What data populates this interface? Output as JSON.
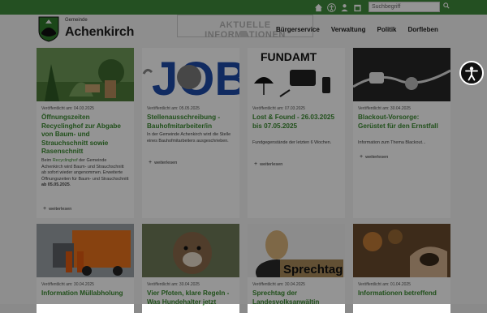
{
  "header": {
    "municipality_small": "Gemeinde",
    "municipality_name": "Achenkirch",
    "notice_title": "AKTUELLE INFORMATIONEN",
    "search_placeholder": "Suchbegriff",
    "nav": [
      "Bürgerservice",
      "Verwaltung",
      "Politik",
      "Dorfleben"
    ]
  },
  "topbar_icons": [
    "home-icon",
    "accessibility-icon",
    "user-icon",
    "calendar-icon"
  ],
  "colors": {
    "brand_green": "#3f8a3b",
    "title_green": "#3a8a30"
  },
  "read_more": "weiterlesen",
  "news": [
    {
      "date": "Veröffentlicht am: 04.03.2025",
      "title": "Öffnungszeiten Recyclinghof zur Abgabe von Baum- und Strauchschnitt sowie Rasenschnitt",
      "body_parts": [
        "Beim ",
        "Recyclinghof",
        " der Gemeinde Achenkirch wird Baum- und Strauchschnitt ab sofort wieder angenommen. Erweiterte Öffnungszeiten für Baum- und Strauchschnitt ",
        "ab 05.05.2025",
        "."
      ]
    },
    {
      "date": "Veröffentlicht am: 05.05.2025",
      "title": "Stellenausschreibung - Bauhofmitarbeiter/in",
      "body": "In der Gemeinde Achenkirch wird die Stelle eines Bauhofmitarbeiters ausgeschrieben."
    },
    {
      "date": "Veröffentlicht am: 07.03.2025",
      "title": "Lost & Found - 26.03.2025 bis 07.05.2025",
      "body": "Fundgegenstände der letzten 6 Wochen."
    },
    {
      "date": "Veröffentlicht am: 30.04.2025",
      "title": "Blackout-Vorsorge: Gerüstet für den Ernstfall",
      "body": "Information zum Thema Blackout..."
    },
    {
      "date": "Veröffentlicht am: 30.04.2025",
      "title": "Information Müllabholung"
    },
    {
      "date": "Veröffentlicht am: 30.04.2025",
      "title": "Vier Pfoten, klare Regeln - Was Hundehalter jetzt"
    },
    {
      "date": "Veröffentlicht am: 30.04.2025",
      "title": "Sprechtag der Landesvolksanwältin"
    },
    {
      "date": "Veröffentlicht am: 01.04.2025",
      "title": "Informationen betreffend"
    }
  ],
  "thumb_text": {
    "fundamt": "FUNDAMT",
    "jobs": "JOB",
    "sprechtag": "Sprechtag"
  }
}
